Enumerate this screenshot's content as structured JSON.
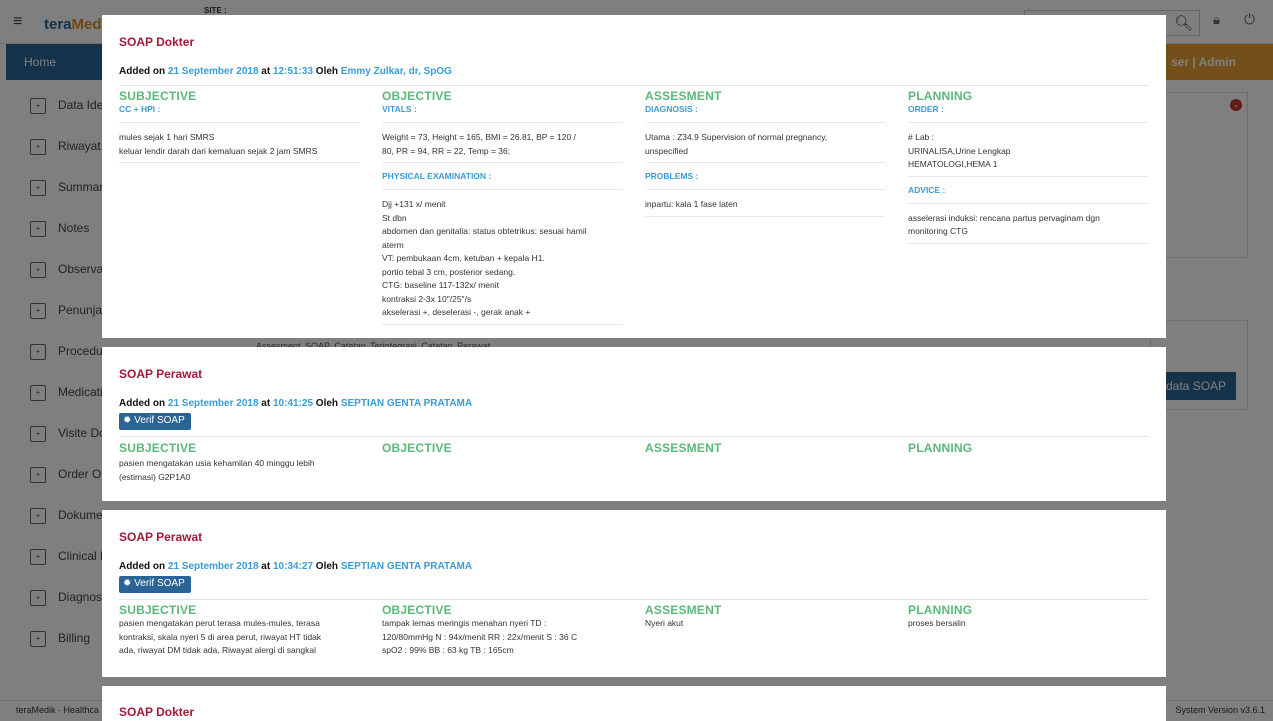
{
  "app": {
    "logo_main": "tera",
    "logo_accent": "Med",
    "site_label": "SITE :",
    "nav_home": "Home",
    "nav_user": "ser | Admin",
    "footer_left": "teraMedik · Healthca",
    "footer_right": "System Version v3.6.1",
    "bg_tabs": "Assesment   SOAP   Catatan Terintegrasi   Catatan Perawat",
    "bg_button": "data SOAP"
  },
  "sidebar": {
    "items": [
      {
        "label": "Data Ide",
        "icon": "id-card-icon"
      },
      {
        "label": "Riwayat",
        "icon": "history-doc-icon"
      },
      {
        "label": "Summar",
        "icon": "summary-doc-icon"
      },
      {
        "label": "Notes",
        "icon": "notes-icon"
      },
      {
        "label": "Observa",
        "icon": "clock-icon"
      },
      {
        "label": "Penunja",
        "icon": "microscope-icon"
      },
      {
        "label": "Procedu",
        "icon": "stethoscope-icon"
      },
      {
        "label": "Medicati",
        "icon": "medication-icon"
      },
      {
        "label": "Visite Do",
        "icon": "visit-icon"
      },
      {
        "label": "Order Ol",
        "icon": "order-icon"
      },
      {
        "label": "Dokume",
        "icon": "document-icon"
      },
      {
        "label": "Clinical F",
        "icon": "clinical-pathway-icon"
      },
      {
        "label": "Diagnos",
        "icon": "diagnosis-icon"
      },
      {
        "label": "Billing",
        "icon": "billing-icon"
      }
    ]
  },
  "cards": [
    {
      "title": "SOAP Dokter",
      "added_prefix": "Added on",
      "date": "21 September 2018",
      "at": "at",
      "time": "12:51:33",
      "by": "Oleh",
      "author": "Emmy Zulkar, dr, SpOG",
      "subjective": {
        "title": "SUBJECTIVE",
        "sub": "CC + HPI :",
        "text": "mules sejak 1 hari SMRS\nkeluar lendir darah dari kemaluan sejak 2 jam SMRS"
      },
      "objective": {
        "title": "OBJECTIVE",
        "sub": "VITALS :",
        "text": "Weight = 73, Height = 165, BMI = 26.81, BP = 120 /\n80, PR = 94, RR = 22, Temp = 36;",
        "sub2": "PHYSICAL EXAMINATION :",
        "text2": "Djj +131 x/ menit\nSt dbn\nabdomen dan genitalia: status obtetrikus: sesuai hamil\naterm\nVT: pembukaan 4cm, ketuban + kepala H1.\nportio tebal 3 cm, posterior sedang.\nCTG: baseline 117-132x/ menit\nkontraksi 2-3x 10\"/25\"/s\nakselerasi +, deselerasi -, gerak anak +"
      },
      "assesment": {
        "title": "ASSESMENT",
        "sub": "DIAGNOSIS :",
        "text": "Utama : Z34.9 Supervision of normal pregnancy,\nunspecified",
        "sub2": "PROBLEMS :",
        "text2": "inpartu: kala 1 fase laten"
      },
      "planning": {
        "title": "PLANNING",
        "sub": "ORDER :",
        "text": "# Lab :\nURINALISA,Urine Lengkap\nHEMATOLOGI,HEMA 1",
        "sub2": "ADVICE :",
        "text2": "asselerasi induksi: rencana partus pervaginam dgn\nmonitoring CTG"
      }
    },
    {
      "title": "SOAP Perawat",
      "added_prefix": "Added on",
      "date": "21 September 2018",
      "at": "at",
      "time": "10:41:25",
      "by": "Oleh",
      "author": "SEPTIAN GENTA PRATAMA",
      "verif": "Verif SOAP",
      "subjective": {
        "title": "SUBJECTIVE",
        "text": "pasien mengatakan usia kehamilan 40 minggu lebih\n(estimasi) G2P1A0"
      },
      "objective": {
        "title": "OBJECTIVE",
        "text": ""
      },
      "assesment": {
        "title": "ASSESMENT",
        "text": ""
      },
      "planning": {
        "title": "PLANNING",
        "text": ""
      }
    },
    {
      "title": "SOAP Perawat",
      "added_prefix": "Added on",
      "date": "21 September 2018",
      "at": "at",
      "time": "10:34:27",
      "by": "Oleh",
      "author": "SEPTIAN GENTA PRATAMA",
      "verif": "Verif SOAP",
      "subjective": {
        "title": "SUBJECTIVE",
        "text": "pasien mengatakan perut terasa mules-mules, terasa\nkontraksi, skala nyeri 5 di area perut, riwayat HT tidak\nada, riwayat DM tidak ada, Riwayat alergi di sangkal"
      },
      "objective": {
        "title": "OBJECTIVE",
        "text": "tampak lemas meringis menahan nyeri TD :\n120/80mmHg N : 94x/menit RR : 22x/menit S : 36 C\nspO2 : 99% BB : 63 kg TB : 165cm"
      },
      "assesment": {
        "title": "ASSESMENT",
        "text": "Nyeri akut"
      },
      "planning": {
        "title": "PLANNING",
        "text": "proses bersalin"
      }
    },
    {
      "title": "SOAP Dokter"
    }
  ]
}
